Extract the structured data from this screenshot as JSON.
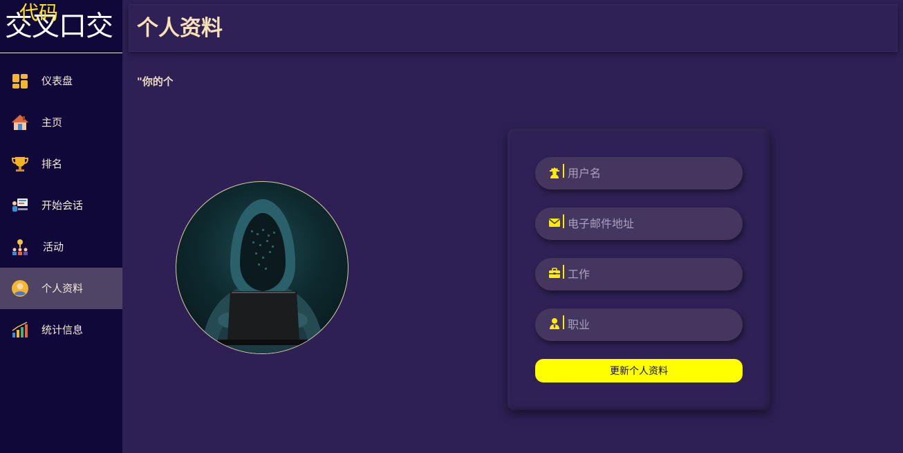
{
  "brand": {
    "main": "交叉口交",
    "superscript": "代码"
  },
  "sidebar": {
    "items": [
      {
        "label": "仪表盘",
        "icon": "dashboard-icon",
        "active": false
      },
      {
        "label": "主页",
        "icon": "home-icon",
        "active": false
      },
      {
        "label": "排名",
        "icon": "trophy-icon",
        "active": false
      },
      {
        "label": "开始会话",
        "icon": "session-icon",
        "active": false
      },
      {
        "label": "活动",
        "icon": "activity-icon",
        "active": false
      },
      {
        "label": "个人资料",
        "icon": "profile-icon",
        "active": true
      },
      {
        "label": "统计信息",
        "icon": "stats-icon",
        "active": false
      }
    ]
  },
  "header": {
    "title": "个人资料"
  },
  "main": {
    "quote": "\"你的个"
  },
  "form": {
    "fields": [
      {
        "placeholder": "用户名",
        "value": "",
        "icon": "user-secret-icon"
      },
      {
        "placeholder": "电子邮件地址",
        "value": "",
        "icon": "envelope-icon"
      },
      {
        "placeholder": "工作",
        "value": "",
        "icon": "briefcase-icon"
      },
      {
        "placeholder": "职业",
        "value": "",
        "icon": "user-tie-icon"
      }
    ],
    "submit_label": "更新个人资料"
  },
  "colors": {
    "background": "#2e2055",
    "sidebar": "#0f0839",
    "sidebar_active": "#4f4366",
    "accent": "#ffff00",
    "title": "#f8e1b6",
    "field": "#453660"
  }
}
